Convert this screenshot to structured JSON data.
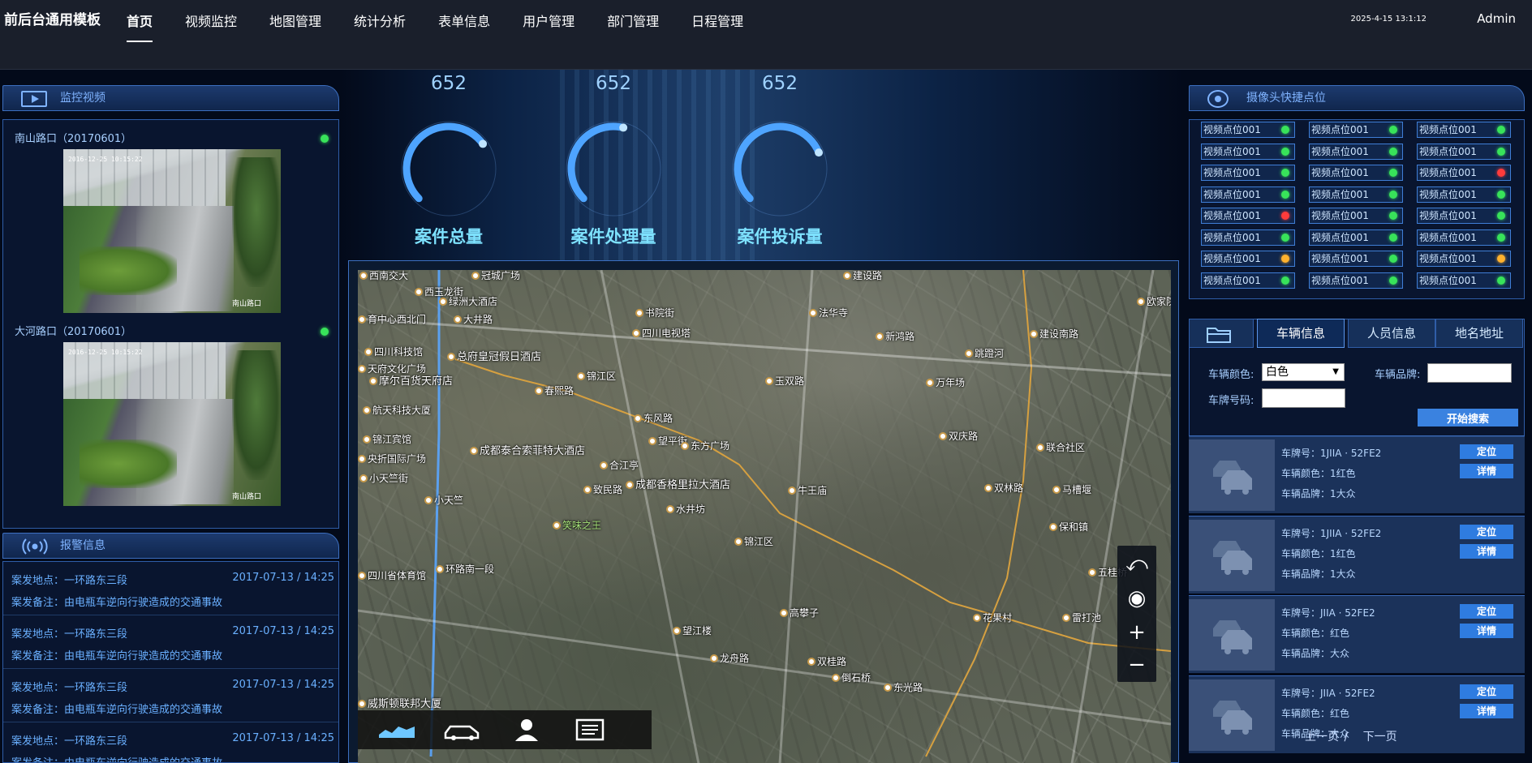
{
  "header": {
    "brand": "前后台通用模板",
    "nav": [
      "首页",
      "视频监控",
      "地图管理",
      "统计分析",
      "表单信息",
      "用户管理",
      "部门管理",
      "日程管理"
    ],
    "active_nav": 0,
    "datetime": "2025-4-15 13:1:12",
    "user": "Admin"
  },
  "monitor": {
    "title": "监控视频",
    "cameras": [
      {
        "label": "南山路口（20170601）",
        "stamp": "2016-12-25 10:15:22",
        "caption": "南山路口"
      },
      {
        "label": "大河路口（20170601）",
        "stamp": "2016-12-25 10:15:22",
        "caption": "南山路口"
      }
    ]
  },
  "alarm": {
    "title": "报警信息",
    "items": [
      {
        "place": "案发地点：一环路东三段",
        "note": "案发备注：由电瓶车逆向行驶造成的交通事故",
        "time": "2017-07-13 / 14:25"
      },
      {
        "place": "案发地点：一环路东三段",
        "note": "案发备注：由电瓶车逆向行驶造成的交通事故",
        "time": "2017-07-13 / 14:25"
      },
      {
        "place": "案发地点：一环路东三段",
        "note": "案发备注：由电瓶车逆向行驶造成的交通事故",
        "time": "2017-07-13 / 14:25"
      },
      {
        "place": "案发地点：一环路东三段",
        "note": "案发备注：由电瓶车逆向行驶造成的交通事故",
        "time": "2017-07-13 / 14:25"
      }
    ]
  },
  "stats": [
    {
      "value": "652",
      "label": "案件总量",
      "progress": 0.7
    },
    {
      "value": "652",
      "label": "案件处理量",
      "progress": 0.55
    },
    {
      "value": "652",
      "label": "案件投诉量",
      "progress": 0.75
    }
  ],
  "map": {
    "labels": [
      "西南交大",
      "冠城广场",
      "建设路",
      "西玉龙街",
      "绿洲大酒店",
      "育中心西北门",
      "大井路",
      "书院街",
      "四川电视塔",
      "法华寺",
      "新鸿路",
      "四川科技馆",
      "总府皇冠假日酒店",
      "建设南路",
      "天府文化广场",
      "锦江区",
      "摩尔百货天府店",
      "春熙路",
      "航天科技大厦",
      "东风路",
      "望平街",
      "东方广场",
      "锦江宾馆",
      "成都泰合索菲特大酒店",
      "央折国际广场",
      "小天竺街",
      "合江亭",
      "致民路",
      "成都香格里拉大酒店",
      "牛王庙",
      "水井坊",
      "小天竺",
      "笑味之王",
      "环路南一段",
      "锦江区",
      "四川省体育馆",
      "望江楼",
      "高攀子",
      "龙舟路",
      "双桂路",
      "倒石桥",
      "威斯顿联邦大厦",
      "东光路",
      "玉双路",
      "万年场",
      "双庆路",
      "联合社区",
      "保和镇",
      "花果村",
      "雷打池",
      "五桂桥",
      "双林路",
      "跳蹬河",
      "欧家院子",
      "马槽堰"
    ],
    "tools": [
      "undo-icon",
      "eye-icon",
      "plus-icon",
      "minus-icon"
    ],
    "bar": [
      "route-icon",
      "car-icon",
      "person-icon",
      "document-icon"
    ]
  },
  "cameras": {
    "title": "摄像头快捷点位",
    "point_label": "视频点位001",
    "statuses": [
      [
        "green",
        "green",
        "green"
      ],
      [
        "green",
        "green",
        "green"
      ],
      [
        "green",
        "green",
        "red"
      ],
      [
        "green",
        "green",
        "green"
      ],
      [
        "red",
        "green",
        "green"
      ],
      [
        "green",
        "green",
        "green"
      ],
      [
        "orange",
        "green",
        "orange"
      ],
      [
        "green",
        "green",
        "green"
      ]
    ]
  },
  "search": {
    "tabs": [
      "车辆信息",
      "人员信息",
      "地名地址"
    ],
    "active_tab": 0,
    "color_label": "车辆颜色:",
    "color_value": "白色",
    "brand_label": "车辆品牌:",
    "brand_value": "",
    "plate_label": "车牌号码:",
    "plate_value": "",
    "button": "开始搜索"
  },
  "vehicles": [
    {
      "plate": "车牌号：1JIIA · 52FE2",
      "color": "车辆颜色：1红色",
      "brand": "车辆品牌：1大众"
    },
    {
      "plate": "车牌号：1JIIA · 52FE2",
      "color": "车辆颜色：1红色",
      "brand": "车辆品牌：1大众"
    },
    {
      "plate": "车牌号：JIIA · 52FE2",
      "color": "车辆颜色：红色",
      "brand": "车辆品牌：大众"
    },
    {
      "plate": "车牌号：JIIA · 52FE2",
      "color": "车辆颜色：红色",
      "brand": "车辆品牌：大众"
    }
  ],
  "vehicle_buttons": {
    "locate": "定位",
    "detail": "详情"
  },
  "pager": {
    "prev": "上一页",
    "sep": "/",
    "next": "下一页"
  }
}
